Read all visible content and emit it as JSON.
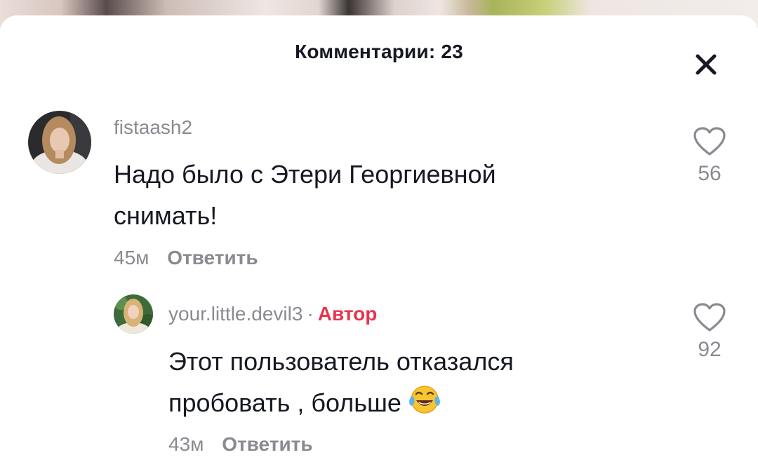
{
  "header": {
    "title": "Комментарии: 23"
  },
  "icons": {
    "close": "close-icon",
    "like": "heart-outline-icon",
    "emoji": "face-with-tears-of-joy-emoji"
  },
  "colors": {
    "text_primary": "#161823",
    "text_secondary": "#8a8b91",
    "author_badge": "#e8334f"
  },
  "comments": [
    {
      "username": "fistaash2",
      "text": "Надо было с Этери Георгиевной снимать!",
      "time": "45м",
      "reply_label": "Ответить",
      "likes": "56"
    }
  ],
  "reply": {
    "username": "your.little.devil3",
    "separator": "·",
    "author_label": "Автор",
    "text": "Этот пользователь отказался пробовать , больше",
    "time": "43м",
    "reply_label": "Ответить",
    "likes": "92"
  }
}
